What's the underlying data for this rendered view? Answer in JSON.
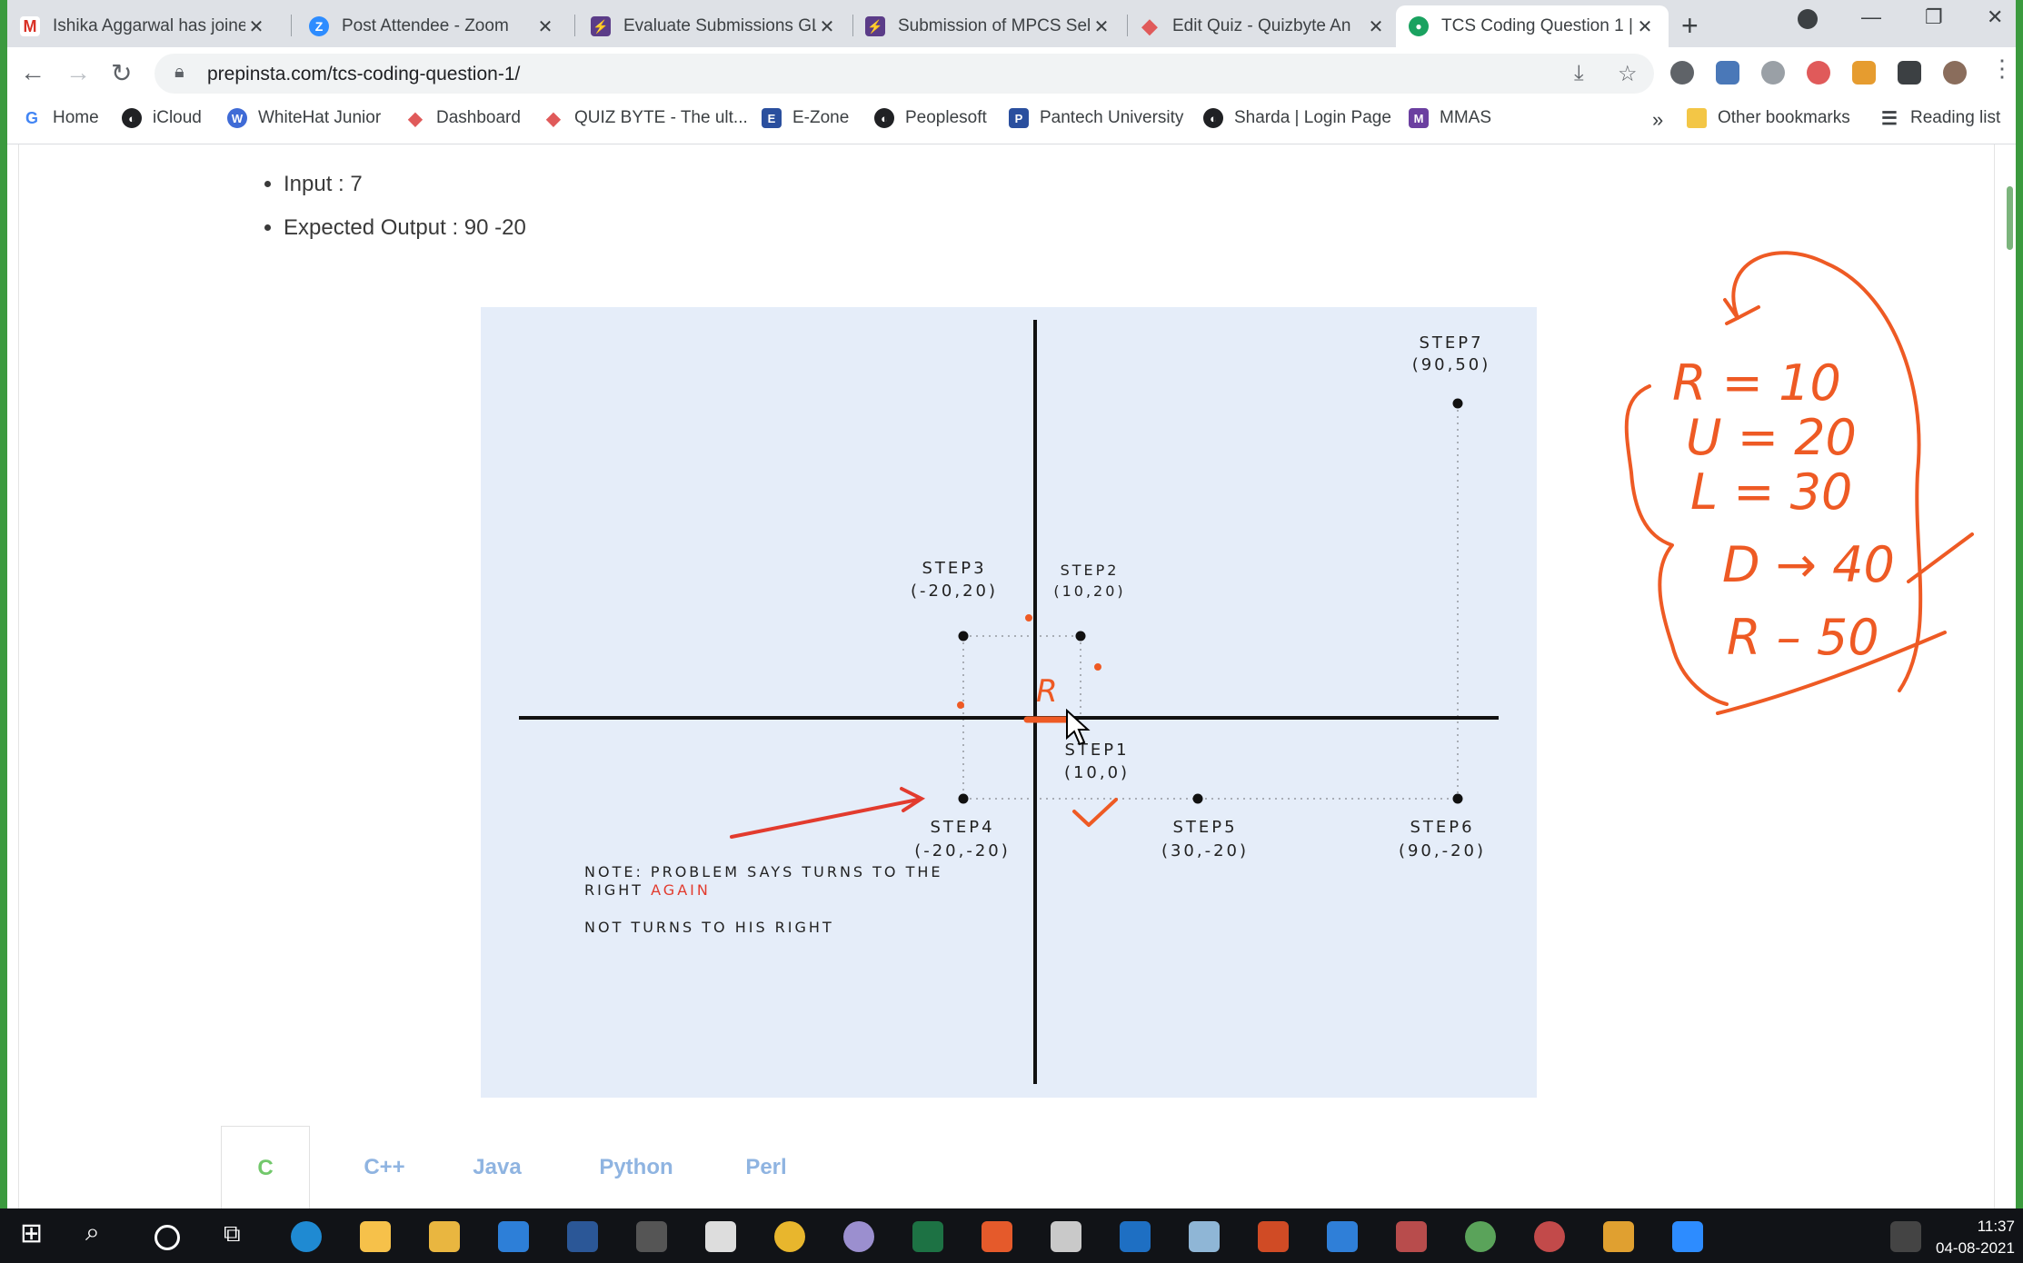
{
  "browser": {
    "tabs": [
      {
        "title": "Ishika Aggarwal has joine",
        "color": "#d93025",
        "glyph": "M"
      },
      {
        "title": "Post Attendee - Zoom",
        "color": "#2d8cff",
        "glyph": "Z"
      },
      {
        "title": "Evaluate Submissions GL",
        "color": "#5b3c88",
        "glyph": "⚡"
      },
      {
        "title": "Submission of MPCS Sel",
        "color": "#5b3c88",
        "glyph": "⚡"
      },
      {
        "title": "Edit Quiz - Quizbyte An",
        "color": "#e05a5a",
        "glyph": "◆"
      },
      {
        "title": "TCS Coding Question 1 |",
        "color": "#1aa260",
        "glyph": "●"
      }
    ],
    "url": "prepinsta.com/tcs-coding-question-1/",
    "bookmarks": [
      {
        "label": "Home",
        "color": "#4285f4",
        "glyph": "G"
      },
      {
        "label": "iCloud",
        "color": "#202124",
        "glyph": "◐"
      },
      {
        "label": "WhiteHat Junior",
        "color": "#3f6bd6",
        "glyph": "W"
      },
      {
        "label": "Dashboard",
        "color": "#e05a5a",
        "glyph": "◆"
      },
      {
        "label": "QUIZ BYTE - The ult...",
        "color": "#e05a5a",
        "glyph": "◆"
      },
      {
        "label": "E-Zone",
        "color": "#2a4f9e",
        "glyph": "E"
      },
      {
        "label": "Peoplesoft",
        "color": "#202124",
        "glyph": "◐"
      },
      {
        "label": "Pantech University",
        "color": "#2a4f9e",
        "glyph": "P"
      },
      {
        "label": "Sharda | Login Page",
        "color": "#202124",
        "glyph": "◐"
      },
      {
        "label": "MMAS",
        "color": "#6b3fa0",
        "glyph": "M"
      }
    ],
    "other_bookmarks": "Other bookmarks",
    "reading_list": "Reading list"
  },
  "content": {
    "input_line": "Input : 7",
    "output_line": "Expected Output : 90 -20",
    "figure": {
      "step7": "STEP7",
      "step7_coord": "(90,50)",
      "step3": "STEP3",
      "step3_coord": "(-20,20)",
      "step2": "STEP2",
      "step2_coord": "(10,20)",
      "step1": "STEP1",
      "step1_coord": "(10,0)",
      "step4": "STEP4",
      "step4_coord": "(-20,-20)",
      "step5": "STEP5",
      "step5_coord": "(30,-20)",
      "step6": "STEP6",
      "step6_coord": "(90,-20)",
      "note_line1": "NOTE: PROBLEM SAYS TURNS TO THE",
      "note_line2_prefix": "RIGHT ",
      "note_line2_again": "AGAIN",
      "note_line3": "NOT TURNS TO HIS RIGHT"
    },
    "language_tabs": [
      "C",
      "C++",
      "Java",
      "Python",
      "Perl"
    ],
    "active_language": "C"
  },
  "handwriting": {
    "r_mark": "R",
    "lines": [
      "R = 10",
      "U = 20",
      "L = 30",
      "D → 40",
      "R – 50"
    ]
  },
  "taskbar": {
    "time": "11:37",
    "date": "04-08-2021"
  },
  "colors": {
    "accent_green": "#3b9a3e",
    "figure_bg": "#e5edf9",
    "annotation_orange": "#ee5a24",
    "annotation_red": "#e23b2e"
  }
}
